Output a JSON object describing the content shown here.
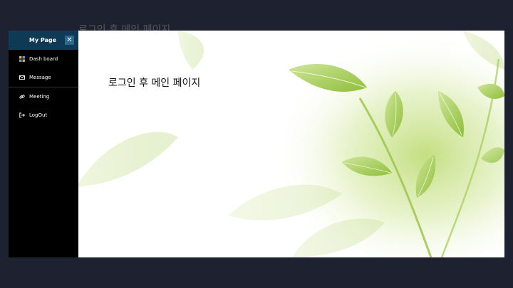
{
  "background_heading": "로그인 후 메인 페이지",
  "sidebar": {
    "title": "My Page",
    "close_icon": "close-icon",
    "items": [
      {
        "label": "Dash board",
        "icon": "grid-icon"
      },
      {
        "label": "Message",
        "icon": "envelope-icon"
      },
      {
        "label": "Meeting",
        "icon": "link-icon"
      },
      {
        "label": "LogOut",
        "icon": "logout-icon"
      }
    ]
  },
  "main": {
    "title": "로그인 후 메인 페이지"
  },
  "colors": {
    "page_background": "#1e2230",
    "sidebar_background": "#000000",
    "sidebar_header": "#0f3a55",
    "close_button": "#2a6a8a",
    "leaf_green": "#a8cf5a"
  }
}
